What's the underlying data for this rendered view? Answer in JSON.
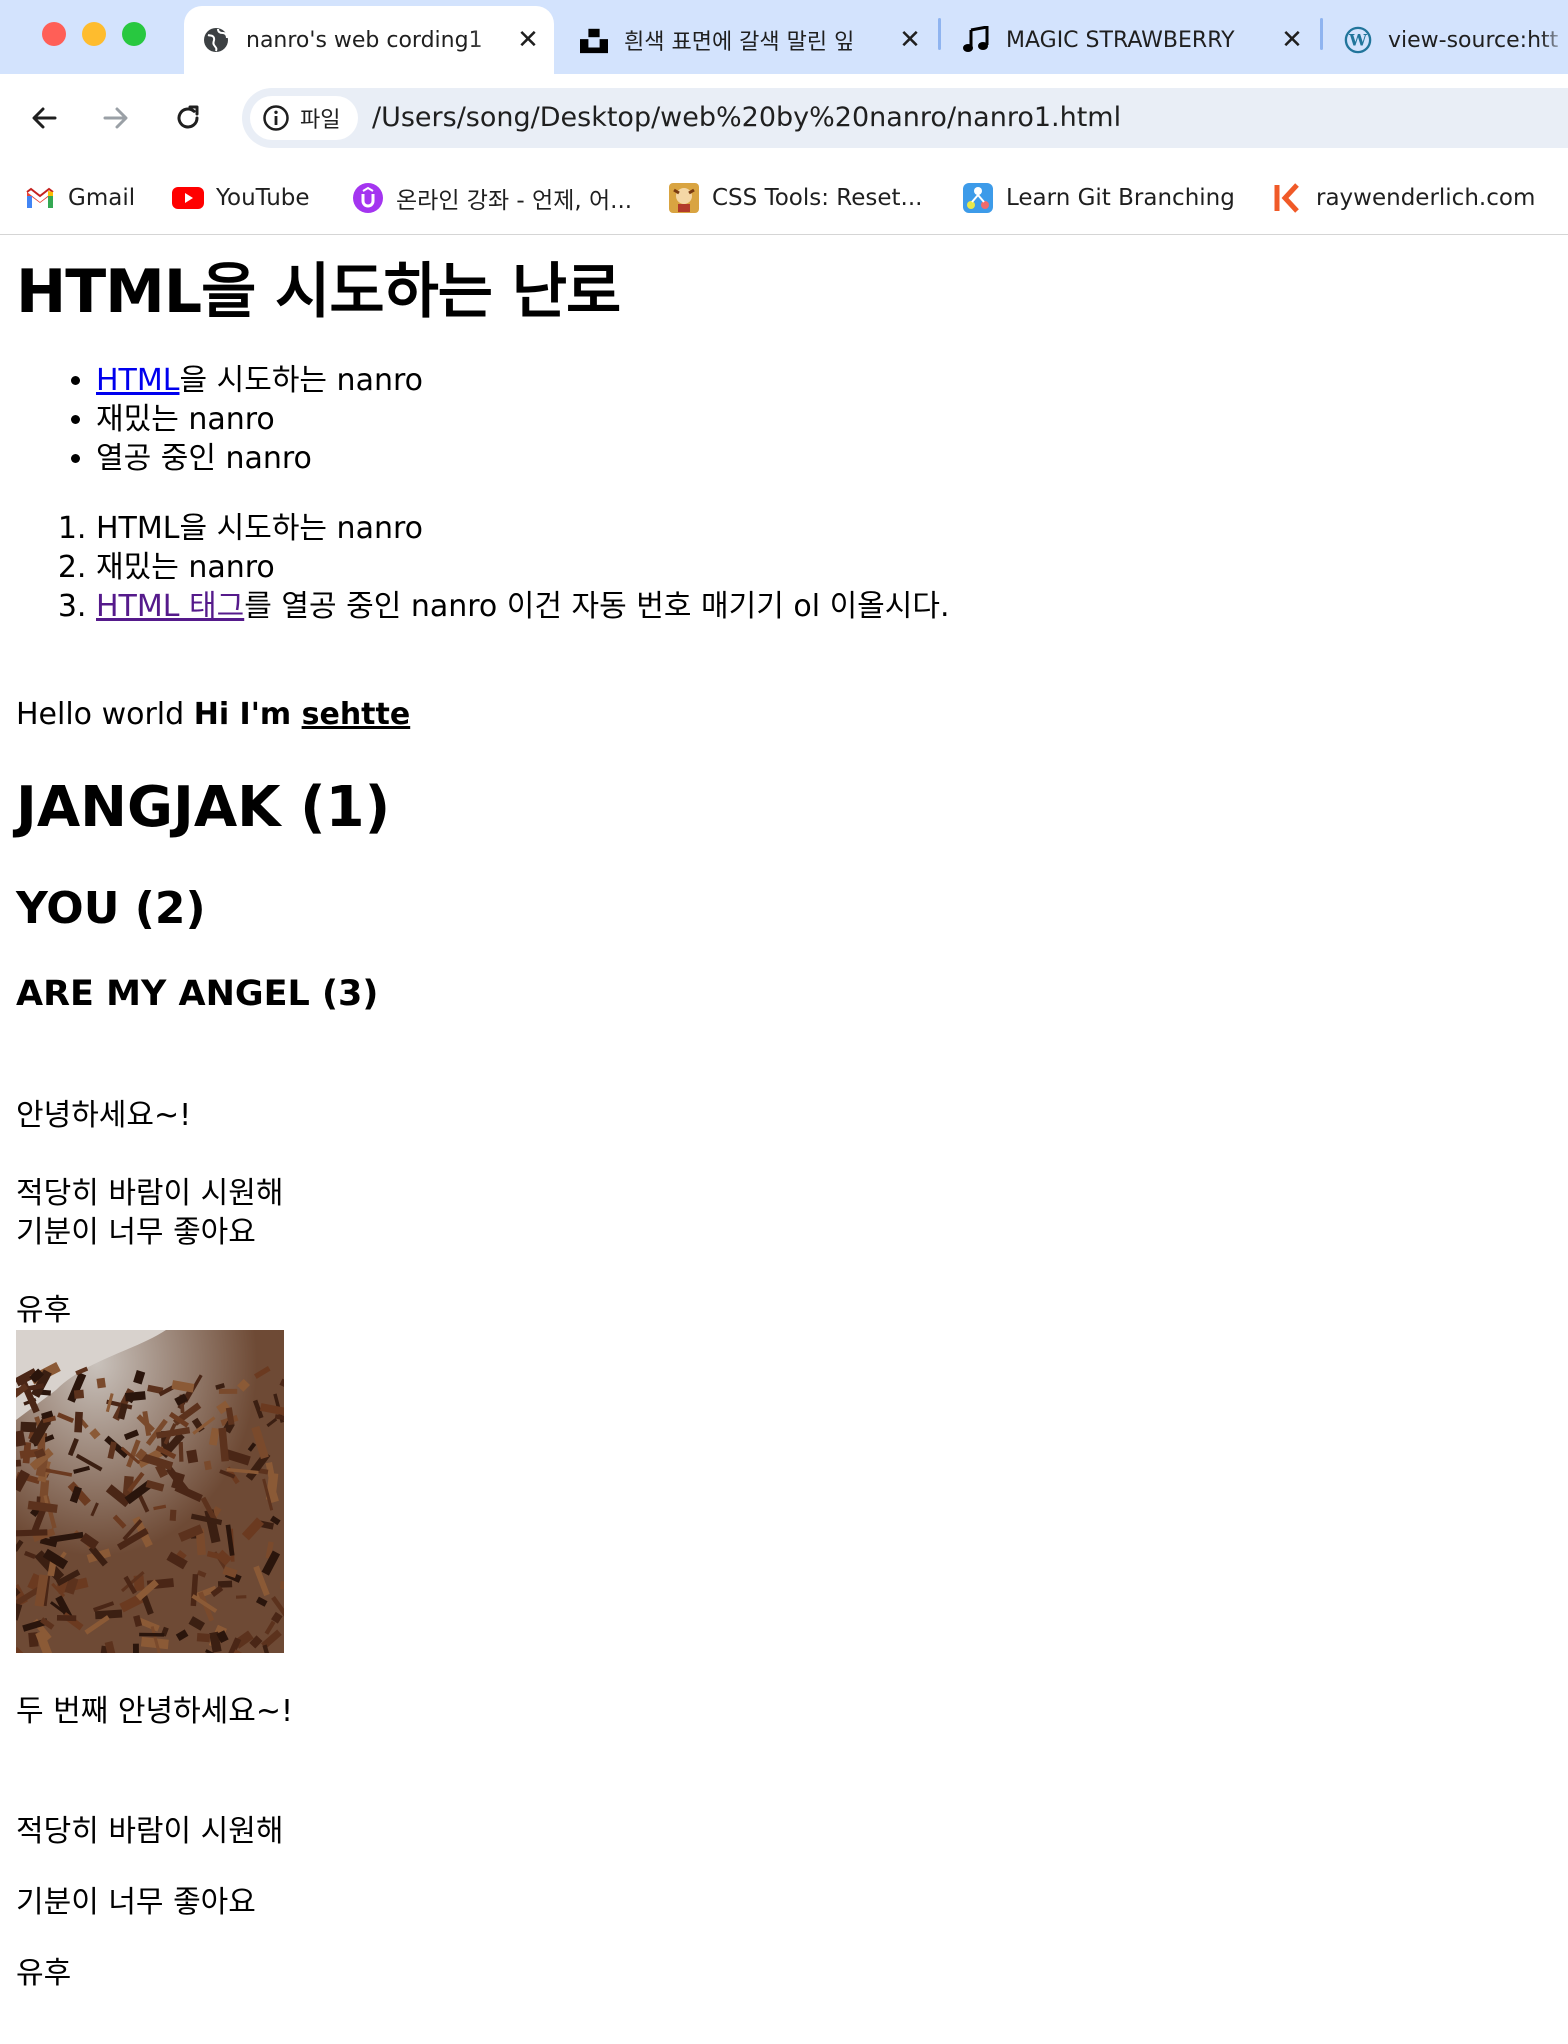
{
  "tabs": [
    {
      "title": "nanro's web cording1",
      "icon": "globe-icon",
      "active": true
    },
    {
      "title": "흰색 표면에 갈색 말린 잎",
      "icon": "unsplash-icon",
      "active": false
    },
    {
      "title": "MAGIC STRAWBERRY",
      "icon": "music-note-icon",
      "active": false
    },
    {
      "title": "view-source:htt",
      "icon": "wordpress-icon",
      "active": false
    }
  ],
  "toolbar": {
    "security_chip": "파일",
    "url": "/Users/song/Desktop/web%20by%20nanro/nanro1.html"
  },
  "bookmarks": [
    {
      "label": "Gmail",
      "icon": "gmail-icon"
    },
    {
      "label": "YouTube",
      "icon": "youtube-icon"
    },
    {
      "label": "온라인 강좌 - 언제, 어...",
      "icon": "udemy-icon"
    },
    {
      "label": "CSS Tools: Reset...",
      "icon": "css-tools-icon"
    },
    {
      "label": "Learn Git Branching",
      "icon": "git-branching-icon"
    },
    {
      "label": "raywenderlich.com",
      "icon": "raywenderlich-icon"
    }
  ],
  "content": {
    "title": "HTML을 시도하는 난로",
    "ul": {
      "item1_link": "HTML",
      "item1_rest": "을 시도하는 nanro",
      "item2": "재밌는 nanro",
      "item3": "열공 중인 nanro"
    },
    "ol": {
      "item1": "HTML을 시도하는 nanro",
      "item2": "재밌는 nanro",
      "item3_link": "HTML 태그",
      "item3_rest": "를 열공 중인 nanro 이건 자동 번호 매기기 ol 이올시다."
    },
    "hello": {
      "plain": "Hello world ",
      "bold": "Hi I'm ",
      "bold_underline": "sehtte"
    },
    "h1": "JANGJAK (1)",
    "h2": "YOU (2)",
    "h3": "ARE MY ANGEL (3)",
    "greeting1": "안녕하세요~!",
    "wind1": "적당히 바람이 시원해",
    "mood1": "기분이 너무 좋아요",
    "yuhoo1": "유후",
    "greeting2": "두 번째 안녕하세요~!",
    "wind2": "적당히 바람이 시원해",
    "mood2": "기분이 너무 좋아요",
    "yuhoo2": "유후"
  },
  "colors": {
    "tabstrip": "#d3e3fd",
    "link": "#0000ee",
    "visited_link": "#551a8b"
  }
}
